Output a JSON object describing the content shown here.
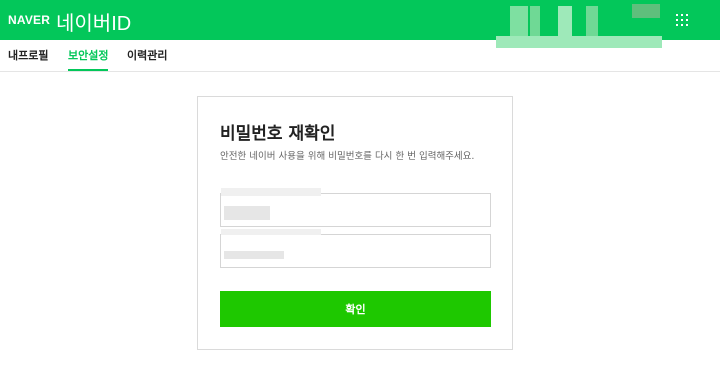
{
  "header": {
    "brand": "NAVER",
    "service_title": "네이버ID",
    "apps_icon": "grid-icon"
  },
  "tabs": [
    {
      "label": "내프로필",
      "active": false
    },
    {
      "label": "보안설정",
      "active": true
    },
    {
      "label": "이력관리",
      "active": false
    }
  ],
  "card": {
    "title": "비밀번호 재확인",
    "description": "안전한 네이버 사용을 위해 비밀번호를 다시 한 번 입력해주세요.",
    "id_field": {
      "value": "",
      "placeholder": ""
    },
    "password_field": {
      "value": "",
      "placeholder": ""
    },
    "confirm_label": "확인"
  },
  "colors": {
    "brand_green": "#03c75a",
    "button_green": "#1ec800",
    "active_tab": "#03c75a"
  }
}
